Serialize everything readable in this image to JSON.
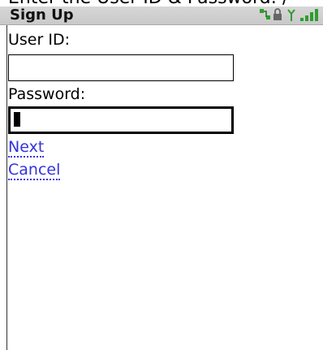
{
  "header": {
    "top_clipped_text": "Enter the User ID & Password: / ",
    "title": "Sign Up"
  },
  "status": {
    "icons": [
      "network-icon",
      "lock-icon",
      "antenna-icon",
      "signal-bars-icon"
    ]
  },
  "form": {
    "user_id_label": "User ID:",
    "user_id_value": "",
    "password_label": "Password:",
    "password_value": ""
  },
  "actions": {
    "next_label": "Next",
    "cancel_label": "Cancel"
  },
  "colors": {
    "link": "#3333dd",
    "title_bar": "#d0d0d0",
    "text": "#000000"
  }
}
